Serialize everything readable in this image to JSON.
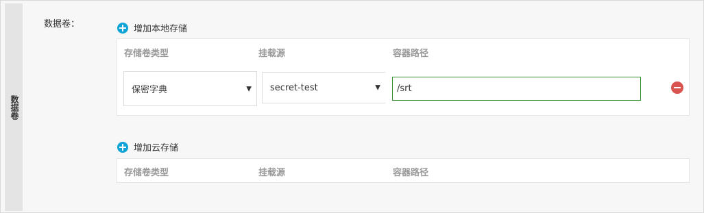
{
  "side_tab": {
    "label": "数据卷"
  },
  "section": {
    "label": "数据卷："
  },
  "local_storage": {
    "add_label": "增加本地存储",
    "columns": [
      "存储卷类型",
      "挂载源",
      "容器路径"
    ],
    "row": {
      "volume_type": "保密字典",
      "mount_source": "secret-test",
      "container_path": "/srt"
    }
  },
  "cloud_storage": {
    "add_label": "增加云存储",
    "columns": [
      "存储卷类型",
      "挂载源",
      "容器路径"
    ]
  },
  "icons": {
    "add": "plus-circle-icon",
    "remove": "minus-circle-icon",
    "dropdown": "caret-down-icon"
  },
  "colors": {
    "accent_blue": "#0fa3d6",
    "remove_red": "#d9534f",
    "focus_green": "#2e8b2e"
  }
}
